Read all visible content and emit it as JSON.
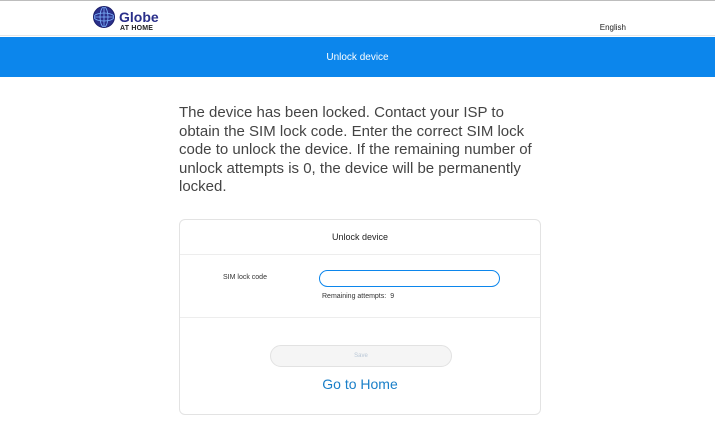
{
  "brand": {
    "name": "Globe",
    "subtitle": "AT HOME"
  },
  "header": {
    "language": "English"
  },
  "banner": {
    "title": "Unlock device"
  },
  "notice": {
    "text": "The device has been locked. Contact your ISP to obtain the SIM lock code. Enter the correct SIM lock code to unlock the device. If the remaining number of unlock attempts is 0, the device will be permanently locked."
  },
  "card": {
    "title": "Unlock device",
    "sim_label": "SIM lock code",
    "sim_value": "",
    "remaining_label": "Remaining attempts:",
    "remaining_value": "9",
    "save_label": "Save",
    "home_link": "Go to Home"
  },
  "colors": {
    "banner": "#0c86ec",
    "link": "#1a7fc8",
    "brand": "#2a2f8a"
  },
  "icons": {
    "logo": "globe-logo-icon"
  }
}
